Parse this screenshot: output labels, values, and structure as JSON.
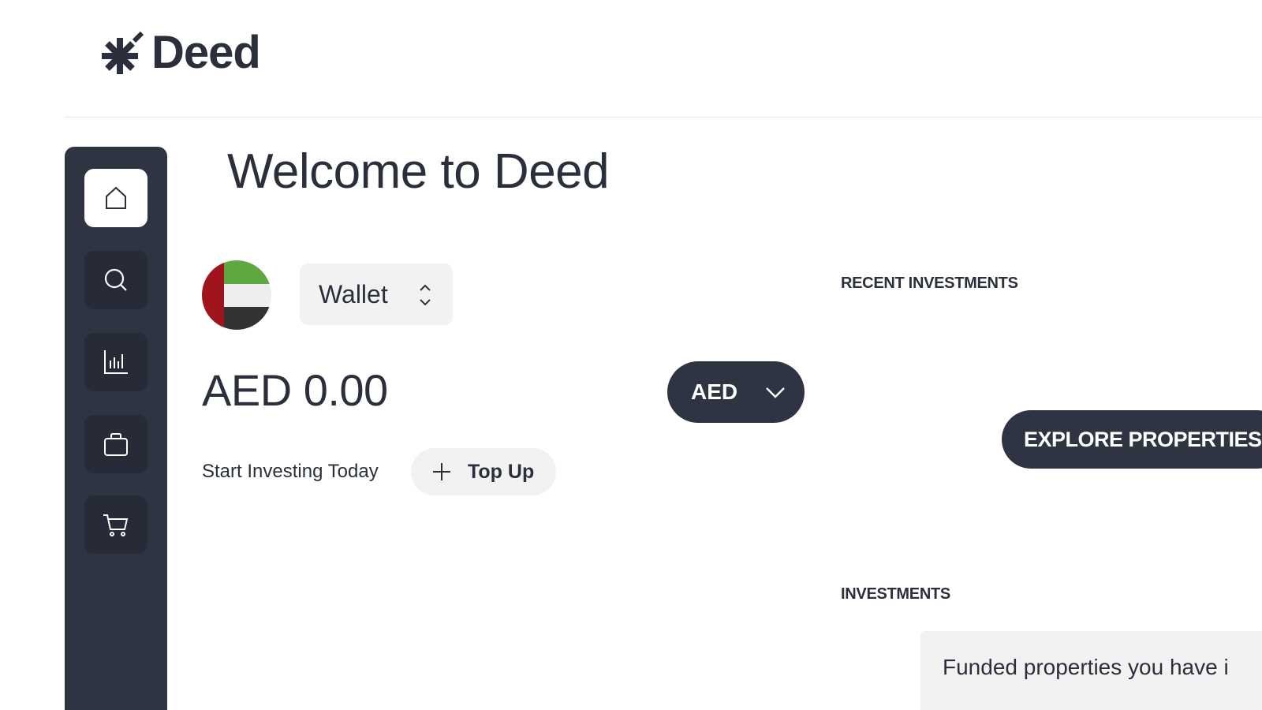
{
  "app": {
    "name": "Deed"
  },
  "sidebar": {
    "items": [
      {
        "icon": "home-icon",
        "active": true
      },
      {
        "icon": "search-icon",
        "active": false
      },
      {
        "icon": "chart-icon",
        "active": false
      },
      {
        "icon": "briefcase-icon",
        "active": false
      },
      {
        "icon": "cart-icon",
        "active": false
      }
    ]
  },
  "main": {
    "title": "Welcome to Deed",
    "wallet": {
      "selector_label": "Wallet",
      "balance": "AED 0.00",
      "currency": "AED",
      "flag": "UAE"
    },
    "start_text": "Start Investing Today",
    "topup_label": "Top Up"
  },
  "right": {
    "recent_title": "RECENT INVESTMENTS",
    "explore_label": "EXPLORE PROPERTIES",
    "investments_title": "INVESTMENTS",
    "funded_text": "Funded properties you have i"
  },
  "colors": {
    "sidebar_bg": "#2e3442",
    "accent_dark": "#2e3442",
    "light_gray": "#f2f2f2"
  }
}
